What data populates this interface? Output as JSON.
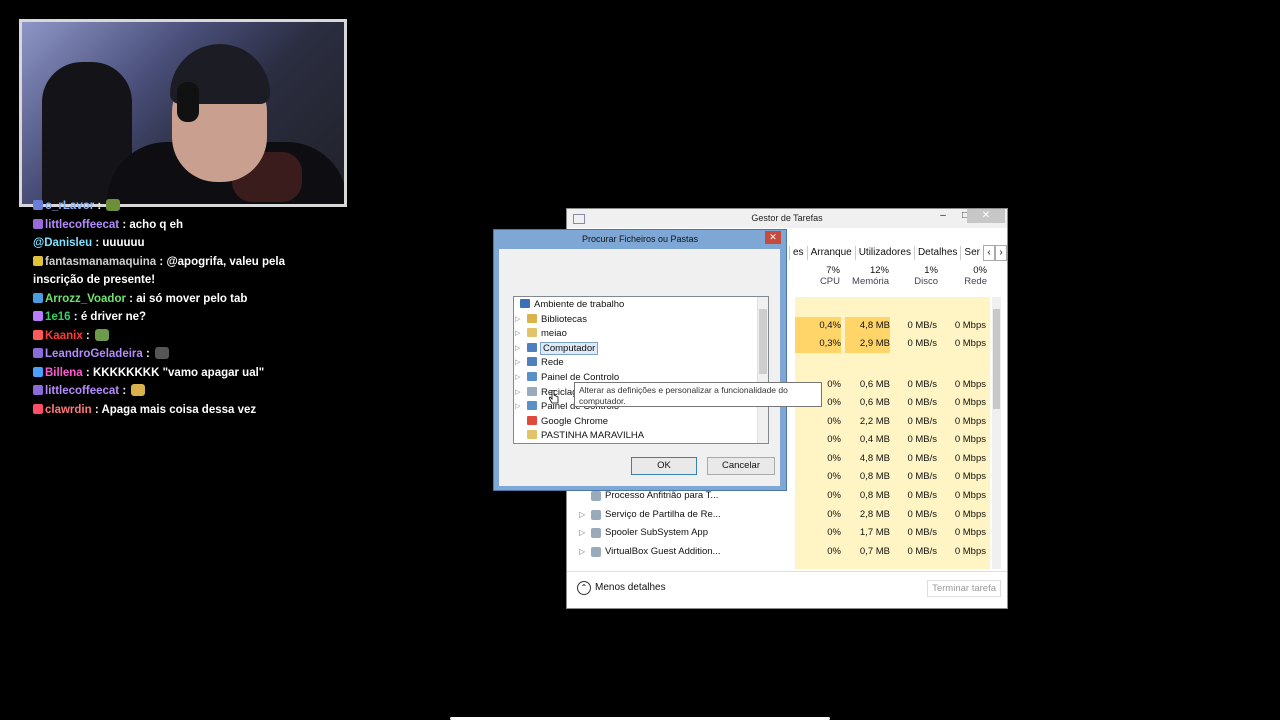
{
  "chat": [
    {
      "user": "o_rLavor",
      "user_color": "#8ab4f8",
      "msg": ""
    },
    {
      "user": "littlecoffeecat",
      "user_color": "#b58cff",
      "msg": "acho q eh"
    },
    {
      "user": "@Danisleu",
      "user_color": "#7fe3ff",
      "msg": "uuuuuu",
      "plain": true
    },
    {
      "user": "fantasmanamaquina",
      "user_color": "#cfcfcf",
      "msg": "@apogrifa, valeu pela inscrição de presente!"
    },
    {
      "user": "Arrozz_Voador",
      "user_color": "#6fe36f",
      "msg": "ai só mover pelo tab"
    },
    {
      "user": "1e16",
      "user_color": "#2fd16a",
      "msg": "é driver ne?"
    },
    {
      "user": "Kaanix",
      "user_color": "#ff3b3b",
      "msg": ""
    },
    {
      "user": "LeandroGeladeira",
      "user_color": "#b58cff",
      "msg": ""
    },
    {
      "user": "Billena",
      "user_color": "#ff5ad1",
      "msg": "KKKKKKKK \"vamo apagar ual\""
    },
    {
      "user": "littlecoffeecat",
      "user_color": "#b58cff",
      "msg": ""
    },
    {
      "user": "clawrdin",
      "user_color": "#ff7a7a",
      "msg": "Apaga mais coisa dessa vez"
    }
  ],
  "task_manager": {
    "title": "Gestor de Tarefas",
    "tabs": [
      "es",
      "Arranque",
      "Utilizadores",
      "Detalhes",
      "Ser"
    ],
    "columns": [
      {
        "pct": "7%",
        "label": "CPU"
      },
      {
        "pct": "12%",
        "label": "Memória"
      },
      {
        "pct": "1%",
        "label": "Disco"
      },
      {
        "pct": "0%",
        "label": "Rede"
      }
    ],
    "rows": [
      {
        "name": "",
        "cpu": "0,4%",
        "mem": "4,8 MB",
        "disk": "0 MB/s",
        "net": "0 Mbps"
      },
      {
        "name": "",
        "cpu": "0,3%",
        "mem": "2,9 MB",
        "disk": "0 MB/s",
        "net": "0 Mbps"
      },
      {
        "name": "",
        "cpu": "0%",
        "mem": "0,6 MB",
        "disk": "0 MB/s",
        "net": "0 Mbps"
      },
      {
        "name": "",
        "cpu": "0%",
        "mem": "0,6 MB",
        "disk": "0 MB/s",
        "net": "0 Mbps"
      },
      {
        "name": "",
        "cpu": "0%",
        "mem": "2,2 MB",
        "disk": "0 MB/s",
        "net": "0 Mbps"
      },
      {
        "name": "",
        "cpu": "0%",
        "mem": "0,4 MB",
        "disk": "0 MB/s",
        "net": "0 Mbps"
      },
      {
        "name": "",
        "cpu": "0%",
        "mem": "4,8 MB",
        "disk": "0 MB/s",
        "net": "0 Mbps"
      },
      {
        "name": "",
        "cpu": "0%",
        "mem": "0,8 MB",
        "disk": "0 MB/s",
        "net": "0 Mbps"
      },
      {
        "name": "Processo Anfitrião para T...",
        "cpu": "0%",
        "mem": "0,8 MB",
        "disk": "0 MB/s",
        "net": "0 Mbps"
      },
      {
        "name": "Serviço de Partilha de Re...",
        "cpu": "0%",
        "mem": "2,8 MB",
        "disk": "0 MB/s",
        "net": "0 Mbps"
      },
      {
        "name": "Spooler SubSystem App",
        "cpu": "0%",
        "mem": "1,7 MB",
        "disk": "0 MB/s",
        "net": "0 Mbps"
      },
      {
        "name": "VirtualBox Guest Addition...",
        "cpu": "0%",
        "mem": "0,7 MB",
        "disk": "0 MB/s",
        "net": "0 Mbps"
      }
    ],
    "less_details": "Menos detalhes",
    "end_task": "Terminar tarefa"
  },
  "folder_dialog": {
    "title": "Procurar Ficheiros ou Pastas",
    "nodes": [
      {
        "label": "Ambiente de trabalho",
        "icon_color": "#3d6fb6"
      },
      {
        "label": "Bibliotecas",
        "icon_color": "#d9b24c"
      },
      {
        "label": "meiao",
        "icon_color": "#e2c36a"
      },
      {
        "label": "Computador",
        "icon_color": "#4f7fbf"
      },
      {
        "label": "Rede",
        "icon_color": "#4f7fbf"
      },
      {
        "label": "Painel de Controlo",
        "icon_color": "#5b8fc7"
      },
      {
        "label": "Reciclagem",
        "icon_color": "#9ab"
      },
      {
        "label": "Painel de Controlo",
        "icon_color": "#5b8fc7"
      },
      {
        "label": "Google Chrome",
        "icon_color": "#e04a3a"
      },
      {
        "label": "PASTINHA MARAVILHA",
        "icon_color": "#e2c36a"
      }
    ],
    "ok": "OK",
    "cancel": "Cancelar",
    "tooltip": "Alterar as definições e personalizar a funcionalidade do computador."
  }
}
